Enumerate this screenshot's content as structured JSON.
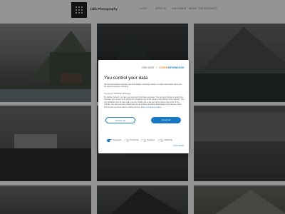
{
  "site": {
    "title": "Jakk Photography"
  },
  "nav": {
    "items": [
      {
        "label": "HOME",
        "active": true
      },
      {
        "label": "ARTICLE"
      },
      {
        "label": "GALLERIES"
      },
      {
        "label": "ABOUT THE ARTS"
      },
      {
        "label": "INFO"
      }
    ]
  },
  "consent": {
    "brand_left": "one.com",
    "brand_plus": "+",
    "brand_cookie": "COOKIE",
    "brand_info": "INFORMATION",
    "title": "You control your data",
    "text": "We and our business partners use technologies, including cookies, to collect information about you for various purposes, including:",
    "purposes": "Functional, Statistical, Marketing",
    "text2": "By clicking 'Accept', you give your consent for all these purposes. You can also choose to specify the purposes you consent to by ticking the checkbox next to the purpose and clicking 'Save settings'. You may withdraw your consent at any time by clicking the small icon at the bottom left corner of the website. You can read more about how we use cookies and other technologies and how we collect and process personal data by clicking the link.",
    "more_link": "Read more about cookies",
    "deny_label": "Decline all",
    "accept_label": "Accept all",
    "toggles": [
      {
        "label": "Necessary",
        "on": true
      },
      {
        "label": "Functional",
        "on": false
      },
      {
        "label": "Statistics",
        "on": false
      },
      {
        "label": "Marketing",
        "on": false
      }
    ],
    "show_details": "Show details"
  },
  "colors": {
    "accent": "#1a7fc1",
    "cookie_brand": "#e8842c"
  }
}
